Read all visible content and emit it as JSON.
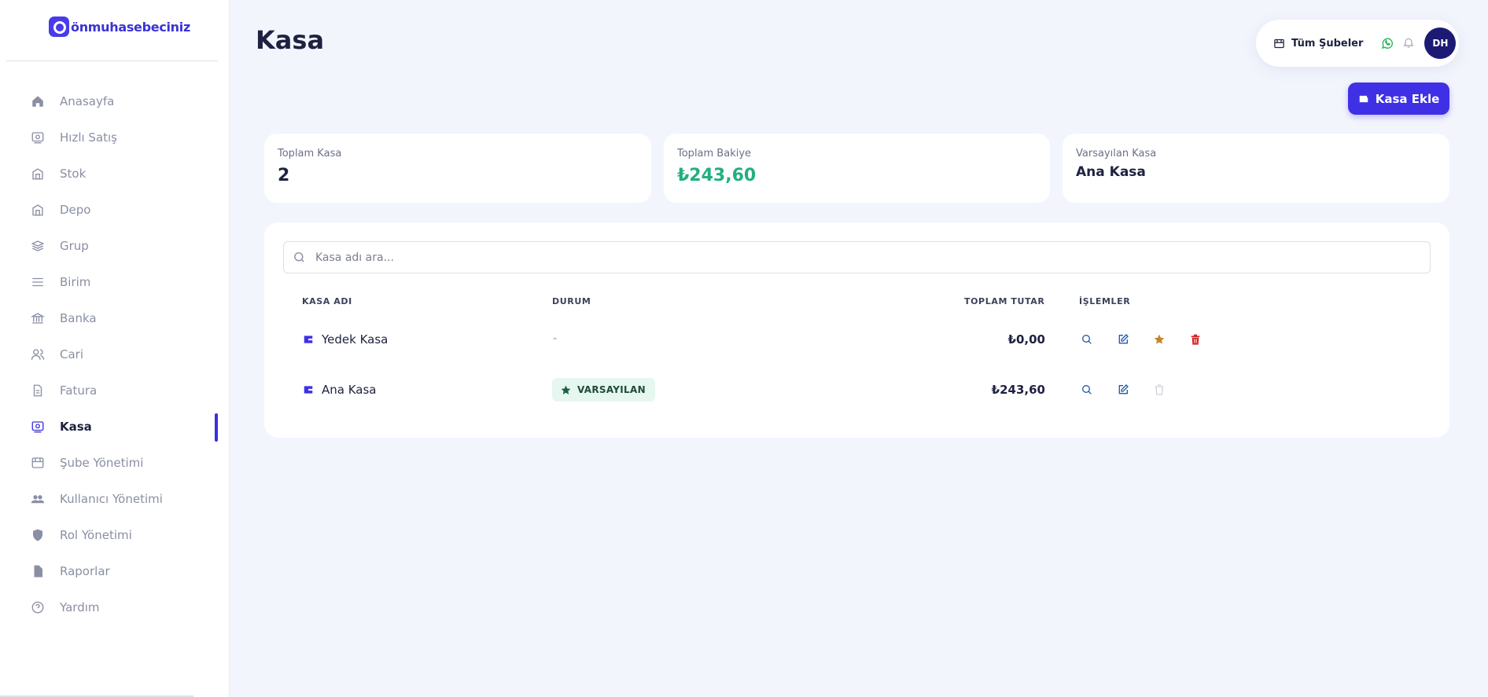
{
  "brand": {
    "name": "önmuhasebeciniz"
  },
  "sidebar": {
    "items": [
      {
        "label": "Anasayfa",
        "icon": "home-icon"
      },
      {
        "label": "Hızlı Satış",
        "icon": "register-icon"
      },
      {
        "label": "Stok",
        "icon": "store-icon"
      },
      {
        "label": "Depo",
        "icon": "warehouse-icon"
      },
      {
        "label": "Grup",
        "icon": "layers-icon"
      },
      {
        "label": "Birim",
        "icon": "menu-icon"
      },
      {
        "label": "Banka",
        "icon": "bank-icon"
      },
      {
        "label": "Cari",
        "icon": "users-icon"
      },
      {
        "label": "Fatura",
        "icon": "invoice-icon"
      },
      {
        "label": "Kasa",
        "icon": "cash-register-icon",
        "active": true
      },
      {
        "label": "Şube Yönetimi",
        "icon": "branch-icon"
      },
      {
        "label": "Kullanıcı Yönetimi",
        "icon": "group-icon"
      },
      {
        "label": "Rol Yönetimi",
        "icon": "shield-icon"
      },
      {
        "label": "Raporlar",
        "icon": "file-icon"
      },
      {
        "label": "Yardım",
        "icon": "help-icon"
      }
    ]
  },
  "header": {
    "title": "Kasa",
    "branch_label": "Tüm Şubeler",
    "avatar_initials": "DH"
  },
  "actions": {
    "add_label": "Kasa Ekle"
  },
  "stats": {
    "total_kasa_label": "Toplam Kasa",
    "total_kasa_value": "2",
    "total_balance_label": "Toplam Bakiye",
    "total_balance_value": "₺243,60",
    "default_kasa_label": "Varsayılan Kasa",
    "default_kasa_value": "Ana Kasa"
  },
  "search": {
    "placeholder": "Kasa adı ara..."
  },
  "table": {
    "headers": {
      "name": "KASA ADI",
      "status": "DURUM",
      "total": "TOPLAM TUTAR",
      "actions": "İŞLEMLER"
    },
    "rows": [
      {
        "name": "Yedek Kasa",
        "status": "-",
        "total": "₺0,00"
      },
      {
        "name": "Ana Kasa",
        "status": "VARSAYILAN",
        "total": "₺243,60"
      }
    ]
  },
  "colors": {
    "accent": "#3f30e6",
    "positive": "#22b07d",
    "danger": "#d42424",
    "star": "#c7862a"
  }
}
